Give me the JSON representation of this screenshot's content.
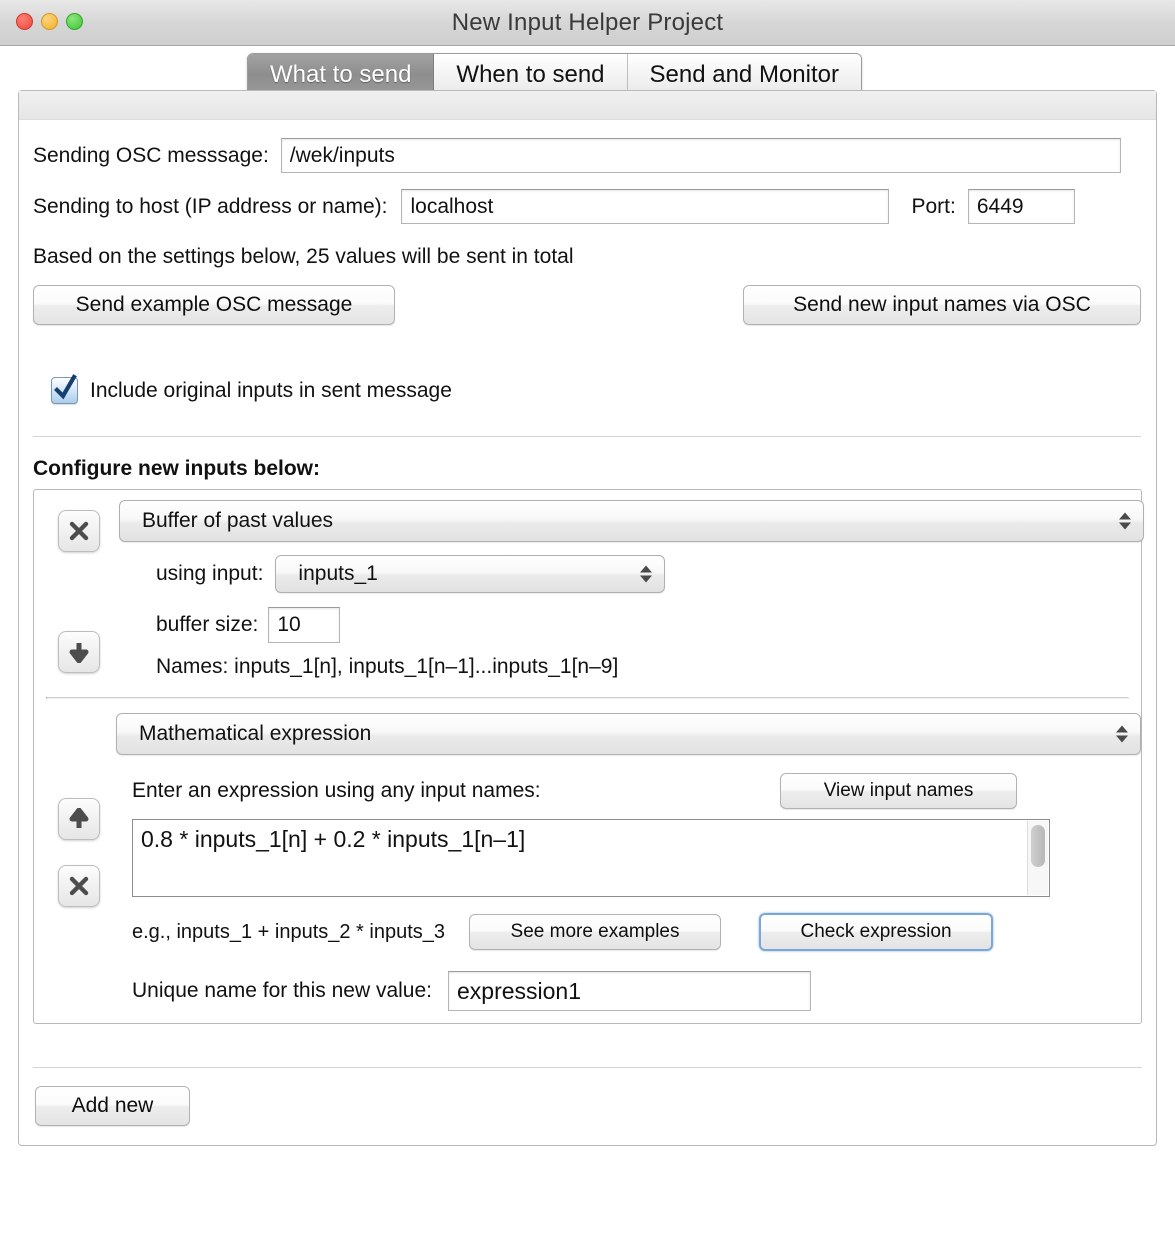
{
  "window": {
    "title": "New Input Helper Project",
    "controls": [
      "close",
      "minimize",
      "zoom"
    ]
  },
  "tabs": [
    {
      "label": "What to send",
      "active": true
    },
    {
      "label": "When to send",
      "active": false
    },
    {
      "label": "Send and Monitor",
      "active": false
    }
  ],
  "osc": {
    "message_label": "Sending OSC messsage:",
    "message_value": "/wek/inputs",
    "host_label": "Sending to host (IP address or name):",
    "host_value": "localhost",
    "port_label": "Port:",
    "port_value": "6449",
    "summary": "Based on the settings below, 25 values will be sent in total",
    "send_example_label": "Send example OSC message",
    "send_names_label": "Send new input names via OSC",
    "include_original_label": "Include original inputs in sent message",
    "include_original_checked": true
  },
  "configure": {
    "heading": "Configure new inputs below:",
    "add_new_label": "Add new"
  },
  "blocks": [
    {
      "type_value": "Buffer of past values",
      "using_input_label": "using input:",
      "using_input_value": "inputs_1",
      "buffer_size_label": "buffer size:",
      "buffer_size_value": "10",
      "names_text": "Names: inputs_1[n], inputs_1[n–1]...inputs_1[n–9]",
      "remove_icon": "x-icon",
      "move_icon": "arrow-down-icon"
    },
    {
      "type_value": "Mathematical expression",
      "prompt": "Enter an expression using any input names:",
      "view_names_label": "View input names",
      "expression_value": "0.8 * inputs_1[n] + 0.2 * inputs_1[n–1]",
      "example_hint": "e.g., inputs_1 + inputs_2 * inputs_3",
      "see_examples_label": "See more examples",
      "check_expression_label": "Check expression",
      "unique_name_label": "Unique name for this new value:",
      "unique_name_value": "expression1",
      "move_icon": "arrow-up-icon",
      "remove_icon": "x-icon"
    }
  ],
  "colors": {
    "focus_ring": "#7aa7d8",
    "checkbox_fill": "#a9cdec",
    "active_tab": "#8e8e8e"
  }
}
